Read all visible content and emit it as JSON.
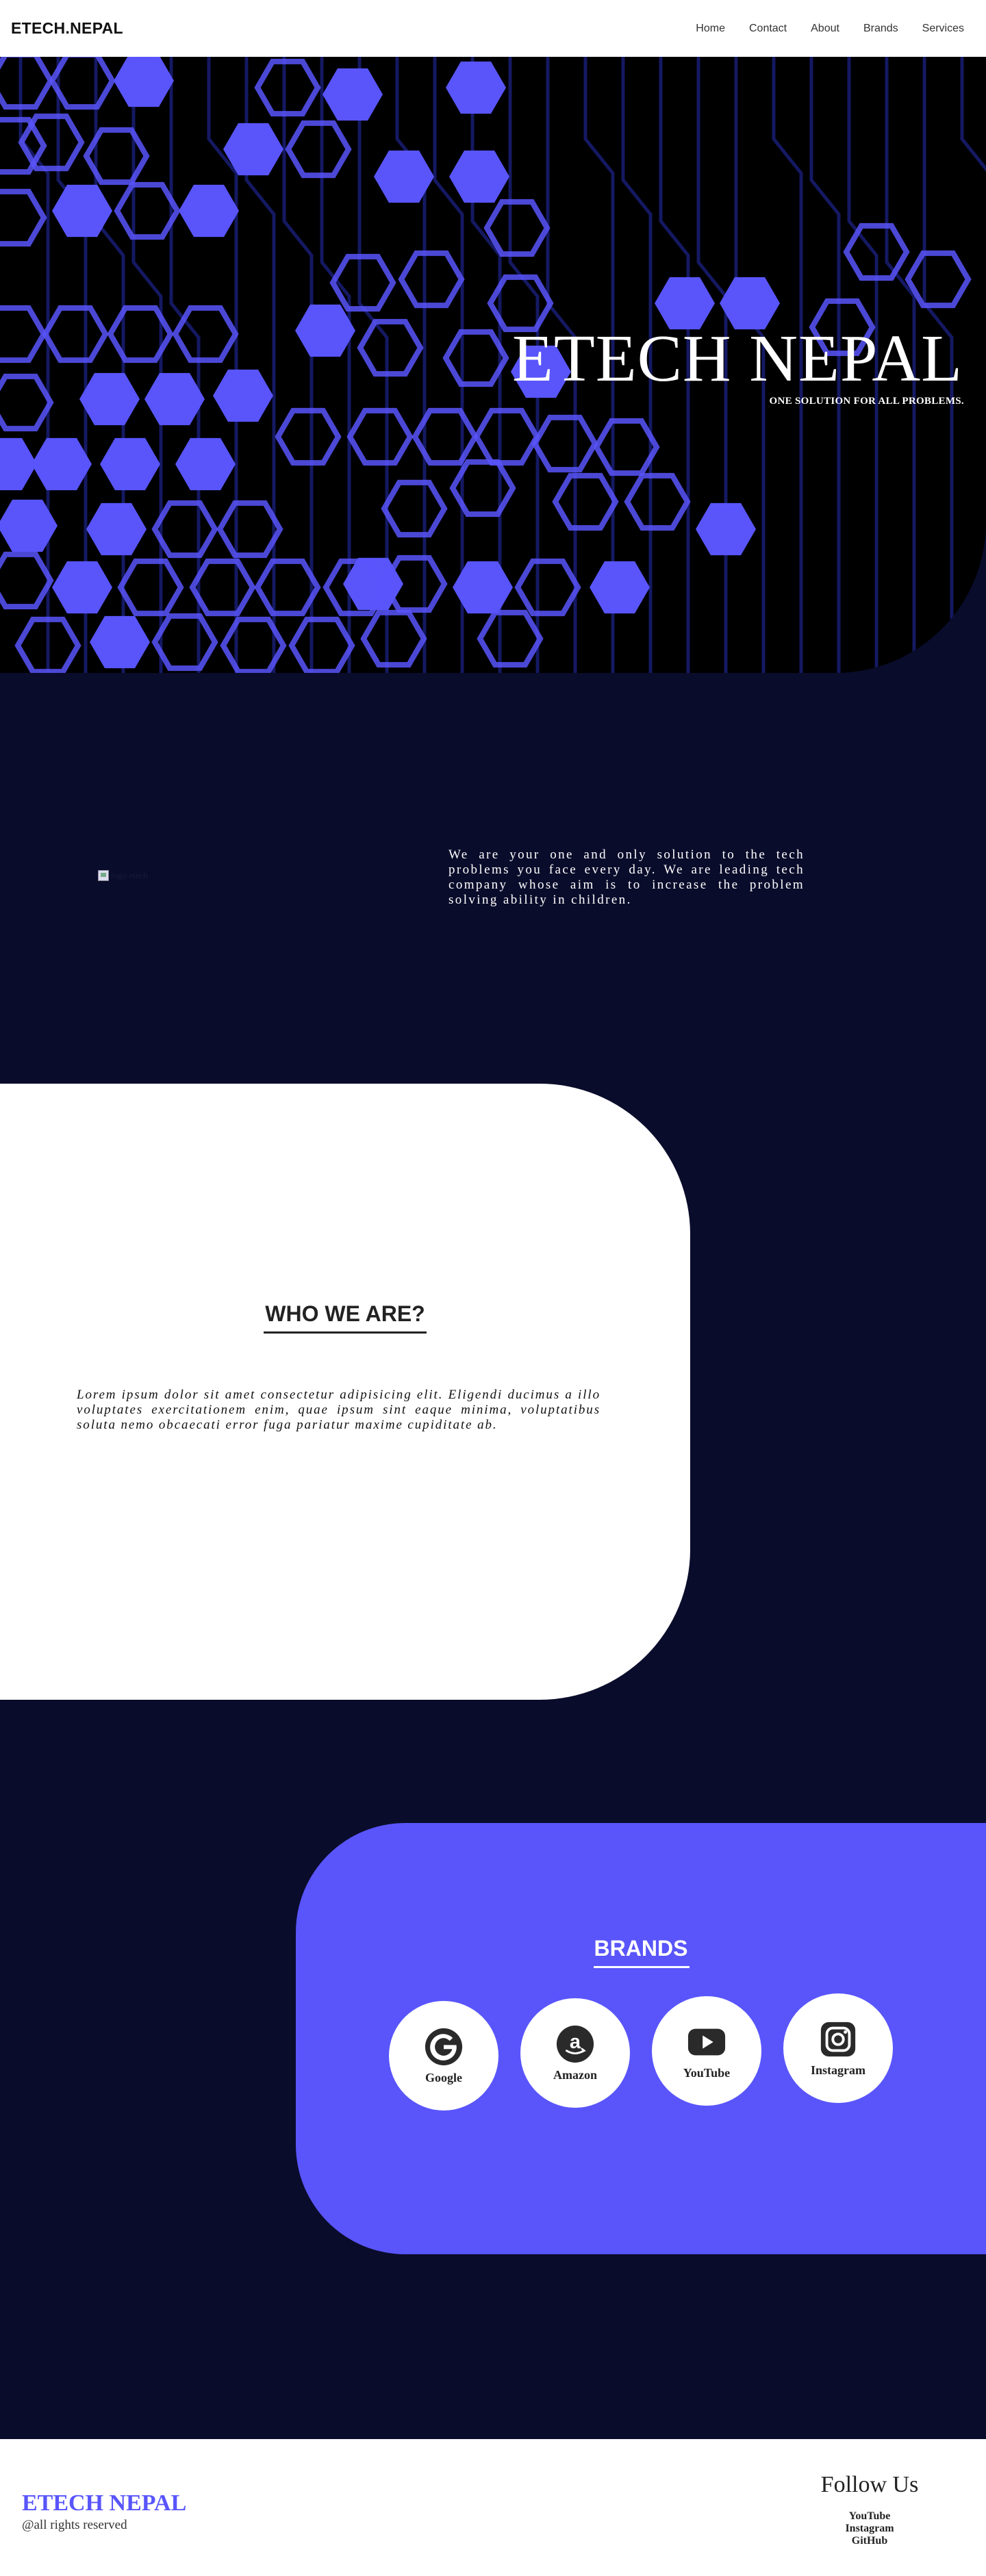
{
  "navbar": {
    "brand": "ETECH.NEPAL",
    "links": [
      "Home",
      "Contact",
      "About",
      "Brands",
      "Services"
    ]
  },
  "hero": {
    "title": "ETECH NEPAL",
    "subtitle": "ONE SOLUTION FOR ALL PROBLEMS.",
    "hexagon_color": "#5955fb"
  },
  "intro": {
    "image_alt": "logo etech",
    "text": "We are your one and only solution to the tech problems you face every day. We are leading tech company whose aim is to increase the problem solving ability in children."
  },
  "who": {
    "title": "WHO WE ARE?",
    "text": "Lorem ipsum dolor sit amet consectetur adipisicing elit. Eligendi ducimus a illo voluptates exercitationem enim, quae ipsum sint eaque minima, voluptatibus soluta nemo obcaecati error fuga pariatur maxime cupiditate ab."
  },
  "brands": {
    "title": "BRANDS",
    "items": [
      {
        "name": "Google",
        "icon": "google-icon"
      },
      {
        "name": "Amazon",
        "icon": "amazon-icon"
      },
      {
        "name": "YouTube",
        "icon": "youtube-icon"
      },
      {
        "name": "Instagram",
        "icon": "instagram-icon"
      }
    ]
  },
  "footer": {
    "brand": "ETECH NEPAL",
    "rights": "@all rights reserved",
    "follow_title": "Follow Us",
    "links": [
      "YouTube",
      "Instagram",
      "GitHub"
    ]
  },
  "colors": {
    "accent": "#5955fb",
    "dark_background": "#0a0c2b",
    "white": "#ffffff"
  }
}
